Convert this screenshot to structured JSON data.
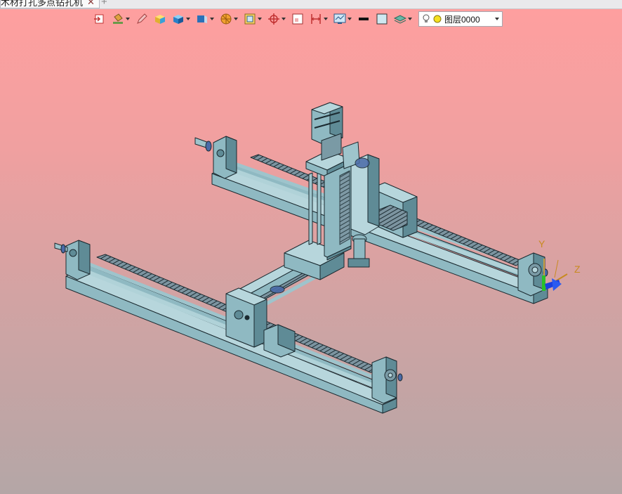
{
  "document_tab": {
    "title": "木材打孔多点钻孔机",
    "close_glyph": "✕"
  },
  "new_tab_glyph": "+",
  "toolbar": {
    "buttons": [
      {
        "icon": "exit-view-icon"
      },
      {
        "icon": "paint-bucket-icon",
        "dropdown": true
      },
      {
        "icon": "pencil-icon"
      },
      {
        "icon": "yellow-cube-icon"
      },
      {
        "icon": "blue-cube-icon",
        "dropdown": true
      },
      {
        "icon": "view-cube-icon",
        "dropdown": true
      },
      {
        "icon": "render-style-icon",
        "dropdown": true
      },
      {
        "icon": "section-frame-icon",
        "dropdown": true
      },
      {
        "icon": "crosshair-icon",
        "dropdown": true
      },
      {
        "icon": "zoom-window-icon"
      },
      {
        "icon": "dimension-icon",
        "dropdown": true
      },
      {
        "icon": "display-settings-icon",
        "dropdown": true
      },
      {
        "icon": "line-weight-icon"
      },
      {
        "icon": "color-swatch-icon"
      },
      {
        "icon": "layer-stack-icon",
        "dropdown": true
      }
    ],
    "layer_selector": {
      "value": "图层0000"
    }
  },
  "viewport": {
    "background_top": "#ff9f9f",
    "background_bottom": "#b4a6a6",
    "axis": {
      "y_label": "Y",
      "z_label": "Z"
    }
  },
  "colors": {
    "part": "#8fb9c2",
    "part_dark": "#5f8b96",
    "part_light": "#b7d6dc",
    "edge": "#1b2a30"
  }
}
